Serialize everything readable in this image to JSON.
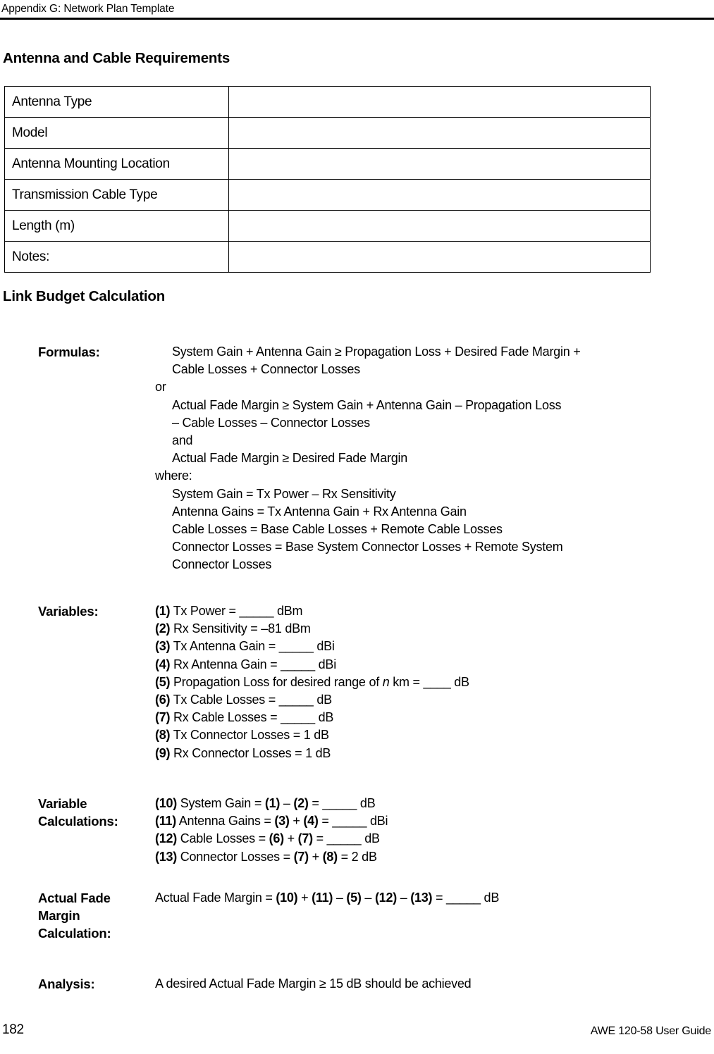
{
  "page": {
    "running_header": "Appendix G: Network Plan Template",
    "footer_page_number": "182",
    "footer_guide_title": "AWE 120-58 User Guide"
  },
  "antenna_section": {
    "heading": "Antenna and Cable Requirements",
    "rows": [
      {
        "label": "Antenna Type",
        "value": ""
      },
      {
        "label": "Model",
        "value": ""
      },
      {
        "label": "Antenna Mounting Location",
        "value": ""
      },
      {
        "label": "Transmission Cable Type",
        "value": ""
      },
      {
        "label": "Length (m)",
        "value": ""
      },
      {
        "label": "Notes:",
        "value": ""
      }
    ]
  },
  "link_budget_section": {
    "heading": "Link Budget Calculation",
    "formulas": {
      "label": "Formulas:",
      "lines": [
        "System Gain + Antenna Gain ≥ Propagation Loss + Desired Fade Margin +",
        "Cable Losses + Connector Losses",
        "or",
        "Actual Fade Margin ≥ System Gain + Antenna Gain – Propagation Loss",
        "– Cable Losses – Connector Losses",
        "and",
        "Actual Fade Margin ≥ Desired Fade Margin",
        "where:",
        "System Gain = Tx Power – Rx Sensitivity",
        "Antenna Gains = Tx Antenna Gain + Rx Antenna Gain",
        "Cable Losses = Base Cable Losses + Remote Cable Losses",
        "Connector Losses = Base System Connector Losses + Remote System",
        "Connector Losses"
      ]
    },
    "variables": {
      "label": "Variables:",
      "items": [
        {
          "number": "(1)",
          "text": "Tx Power = _____ dBm"
        },
        {
          "number": "(2)",
          "text": "Rx Sensitivity = –81 dBm"
        },
        {
          "number": "(3)",
          "text": "Tx Antenna Gain = _____ dBi"
        },
        {
          "number": "(4)",
          "text": "Rx Antenna Gain = _____ dBi"
        },
        {
          "number": "(5)",
          "text": "Propagation Loss for desired range of n km = ____ dB"
        },
        {
          "number": "(6)",
          "text": "Tx Cable Losses = _____ dB"
        },
        {
          "number": "(7)",
          "text": "Rx Cable Losses = _____ dB"
        },
        {
          "number": "(8)",
          "text": "Tx Connector Losses = 1 dB"
        },
        {
          "number": "(9)",
          "text": "Rx Connector Losses = 1 dB"
        }
      ]
    },
    "variable_calculations": {
      "label_line1": "Variable",
      "label_line2": "Calculations:",
      "items": [
        {
          "number": "(10)",
          "text": "System Gain = (1) – (2) = _____ dB"
        },
        {
          "number": "(11)",
          "text": "Antenna Gains = (3) + (4) = _____ dBi"
        },
        {
          "number": "(12)",
          "text": "Cable Losses = (6) + (7) = _____ dB"
        },
        {
          "number": "(13)",
          "text": "Connector Losses = (7) + (8) = 2 dB"
        }
      ]
    },
    "actual_fade_margin": {
      "label_line1": "Actual Fade",
      "label_line2": "Margin",
      "label_line3": "Calculation:",
      "line": "Actual Fade Margin = (10) + (11) – (5) – (12) – (13) = _____ dB"
    },
    "analysis": {
      "label": "Analysis:",
      "line": "A desired Actual Fade Margin ≥ 15 dB should be achieved"
    }
  }
}
